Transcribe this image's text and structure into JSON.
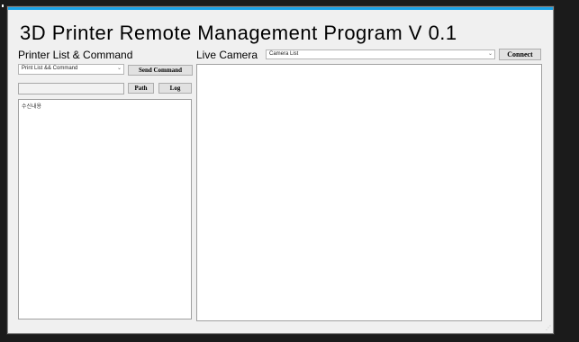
{
  "window": {
    "title": "3D Printer Remote Management Program V 0.1"
  },
  "left_panel": {
    "label": "Printer List & Command",
    "combo_value": "Print List && Command",
    "send_button": "Send Command",
    "path_value": "",
    "path_button": "Path",
    "log_button": "Log",
    "received_label": "수신내용"
  },
  "right_panel": {
    "label": "Live Camera",
    "camera_combo_value": "Camera List",
    "connect_button": "Connect"
  },
  "colors": {
    "accent": "#1aa3e8",
    "window_bg": "#f0f0f0",
    "desktop_bg": "#1b1b1b"
  }
}
